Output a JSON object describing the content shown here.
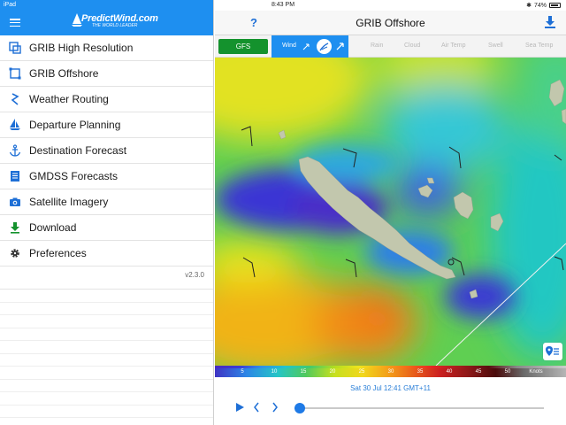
{
  "statusbar": {
    "device": "iPad",
    "time": "8:43 PM",
    "battery": "74%"
  },
  "sidebar": {
    "brand": "PredictWind.com",
    "tagline": "THE WORLD LEADER",
    "items": [
      {
        "label": "GRIB High Resolution",
        "icon": "grib-highres-icon"
      },
      {
        "label": "GRIB Offshore",
        "icon": "grib-offshore-icon"
      },
      {
        "label": "Weather Routing",
        "icon": "weather-routing-icon"
      },
      {
        "label": "Departure Planning",
        "icon": "sailboat-icon"
      },
      {
        "label": "Destination Forecast",
        "icon": "anchor-icon"
      },
      {
        "label": "GMDSS Forecasts",
        "icon": "document-icon"
      },
      {
        "label": "Satellite Imagery",
        "icon": "camera-icon"
      },
      {
        "label": "Download",
        "icon": "download-icon"
      },
      {
        "label": "Preferences",
        "icon": "gear-icon"
      }
    ],
    "version": "v2.3.0"
  },
  "header": {
    "help": "?",
    "title": "GRIB Offshore"
  },
  "tabs": {
    "model": "GFS",
    "active": "Wind",
    "others": [
      "Rain",
      "Cloud",
      "Air Temp",
      "Swell",
      "Sea Temp"
    ]
  },
  "scale": {
    "ticks": [
      "5",
      "10",
      "15",
      "20",
      "25",
      "30",
      "35",
      "40",
      "45",
      "50"
    ],
    "unit": "Knots"
  },
  "controls": {
    "date": "Sat 30 Jul 12:41 GMT+11",
    "slider_position": 0.0
  },
  "colors": {
    "accent": "#1e8ff0",
    "gfs": "#14922d",
    "link": "#2a7fd8"
  }
}
